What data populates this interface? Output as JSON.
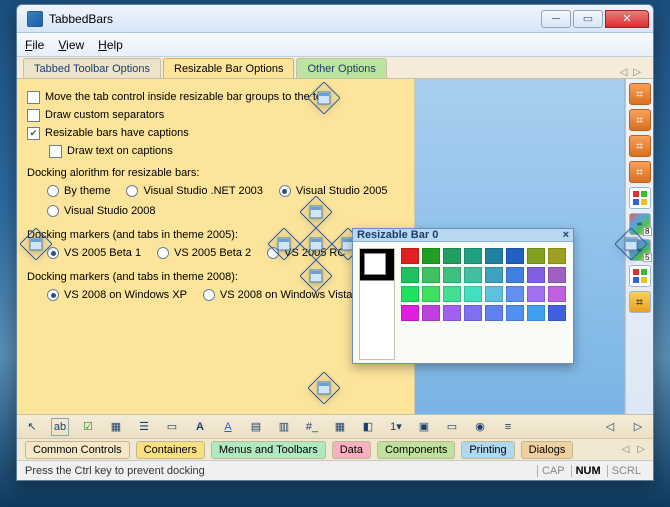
{
  "window": {
    "title": "TabbedBars"
  },
  "menu": {
    "file": "File",
    "view": "View",
    "help": "Help"
  },
  "tabs": {
    "toolbar": "Tabbed Toolbar Options",
    "resizable": "Resizable Bar Options",
    "other": "Other Options"
  },
  "options": {
    "move_top": "Move the tab control inside resizable bar groups to the top",
    "custom_sep": "Draw custom separators",
    "have_captions": "Resizable bars have captions",
    "draw_text": "Draw text on captions",
    "dock_algo_label": "Docking alorithm for resizable bars:",
    "algo": {
      "bytheme": "By theme",
      "vs2003": "Visual Studio .NET 2003",
      "vs2005": "Visual Studio 2005",
      "vs2008": "Visual Studio 2008"
    },
    "markers2005_label": "Docking markers (and tabs in theme 2005):",
    "m2005": {
      "b1": "VS 2005 Beta 1",
      "b2": "VS 2005 Beta 2",
      "rc": "VS 2005 RC"
    },
    "markers2008_label": "Docking markers (and tabs in theme 2008):",
    "m2008": {
      "xp": "VS 2008 on Windows XP",
      "vista": "VS 2008 on Windows Vista"
    }
  },
  "floating": {
    "title": "Resizable Bar 0",
    "close": "×"
  },
  "color_grid": [
    "#e02020",
    "#20a020",
    "#20a060",
    "#20a080",
    "#2080a0",
    "#2060c0",
    "#80a020",
    "#a0a020",
    "#20c060",
    "#40c060",
    "#40c080",
    "#40c0a0",
    "#40a0c0",
    "#4080e0",
    "#8060e0",
    "#a060c0",
    "#20e060",
    "#40e060",
    "#40e090",
    "#40e0c0",
    "#60c0e0",
    "#6090f0",
    "#a070f0",
    "#c060e0",
    "#e020e0",
    "#c040e0",
    "#a060f0",
    "#8070f0",
    "#6080f0",
    "#5090f0",
    "#40a0f0",
    "#4060e0"
  ],
  "palette_tabs": {
    "common": "Common Controls",
    "containers": "Containers",
    "menus": "Menus and Toolbars",
    "data": "Data",
    "components": "Components",
    "printing": "Printing",
    "dialogs": "Dialogs"
  },
  "palette_colors": {
    "common": "#f4e8c8",
    "containers": "#f8e080",
    "menus": "#b0e8c0",
    "data": "#f8b0c0",
    "components": "#c0e0a0",
    "printing": "#b0d8f0",
    "dialogs": "#f0d0a0"
  },
  "status": {
    "hint": "Press the Ctrl key to prevent docking",
    "cap": "CAP",
    "num": "NUM",
    "scrl": "SCRL"
  },
  "right_tools": [
    "office",
    "office",
    "office",
    "office",
    "winflag",
    "vs",
    "vs",
    "winflag",
    "office2"
  ]
}
